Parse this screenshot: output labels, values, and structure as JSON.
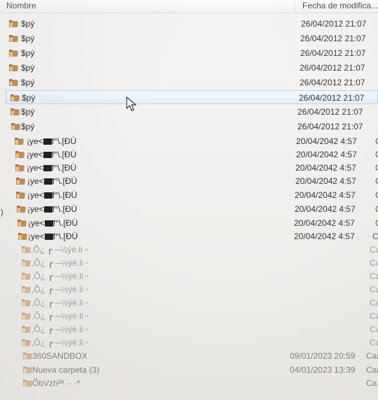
{
  "header": {
    "name_label": "Nombre",
    "date_label": "Fecha de modifica..."
  },
  "files": [
    {
      "name": "$pý",
      "date": "26/04/2012 21:07",
      "type": ""
    },
    {
      "name": "$pý",
      "date": "26/04/2012 21:07",
      "type": ""
    },
    {
      "name": "$pý",
      "date": "26/04/2012 21:07",
      "type": ""
    },
    {
      "name": "$pý",
      "date": "26/04/2012 21:07",
      "type": ""
    },
    {
      "name": "$pý",
      "date": "26/04/2012 21:07",
      "type": ""
    },
    {
      "name": "$pý",
      "date": "26/04/2012 21:07",
      "type": "",
      "selected": true
    },
    {
      "name": "$pý",
      "date": "26/04/2012 21:07",
      "type": ""
    },
    {
      "name": "$pý",
      "date": "26/04/2012 21:07",
      "type": ""
    },
    {
      "name_prefix": "¡ye<",
      "name_suffix": "f°\\.[ĐÙ",
      "date": "20/04/2042 4:57",
      "type": "C"
    },
    {
      "name_prefix": "¡ye<",
      "name_suffix": "f°\\.[ĐÙ",
      "date": "20/04/2042 4:57",
      "type": "C"
    },
    {
      "name_prefix": "¡ye<",
      "name_suffix": "f°\\.[ĐÙ",
      "date": "20/04/2042 4:57",
      "type": "C"
    },
    {
      "name_prefix": "¡ye<",
      "name_suffix": "f°\\.[ĐÙ",
      "date": "20/04/2042 4:57",
      "type": "C"
    },
    {
      "name_prefix": "¡ye<",
      "name_suffix": "f°\\.[ĐÙ",
      "date": "20/04/2042 4:57",
      "type": "C"
    },
    {
      "name_prefix": "¡ye<",
      "name_suffix": "f°\\.[ĐÙ",
      "date": "20/04/2042 4:57",
      "type": "C"
    },
    {
      "name_prefix": "¡ye<",
      "name_suffix": "f°\\.[ĐÙ",
      "date": "20/04/2042 4:57",
      "type": "C"
    },
    {
      "name_prefix": "¡ye<",
      "name_suffix": "f°\\.[ĐÙ",
      "date": "20/04/2042 4:57",
      "type": "Ca"
    },
    {
      "name": ",Õ¿ ┏ ─½ýë.li╶",
      "date": "",
      "type": "Ca"
    },
    {
      "name": ",Õ¿ ┏ ─½ýë.li╶",
      "date": "",
      "type": "Ca"
    },
    {
      "name": ",Õ¿ ┏ ─½ýë.li╶",
      "date": "",
      "type": "Ca"
    },
    {
      "name": ",Õ¿ ┏ ─½ýë.li╶",
      "date": "",
      "type": "Ca"
    },
    {
      "name": ",Õ¿ ┏ ─½ýë.li╶",
      "date": "",
      "type": "Ca"
    },
    {
      "name": ",Õ¿ ┏ ─½ýë.li╶",
      "date": "",
      "type": "Ca"
    },
    {
      "name": ",Õ¿ ┏ ─½ýë.li╶",
      "date": "",
      "type": "Ca"
    },
    {
      "name": ",Õ¿ ┏ ─½ýë.li╶",
      "date": "",
      "type": "Ca"
    },
    {
      "name": "360SANDBOX",
      "date": "09/01/2023 20:59",
      "type": "Car"
    },
    {
      "name": "Nueva carpeta (3)",
      "date": "04/01/2023 13:39",
      "type": "Car"
    },
    {
      "name": "ÕbVzh²ª ·· ·* ",
      "date": "",
      "type": "Ca"
    }
  ],
  "colors": {
    "folder_body": "#c08a4a",
    "folder_tab": "#a06a2e",
    "selection_border": "#bcd3ee"
  },
  "left_mark": ")"
}
